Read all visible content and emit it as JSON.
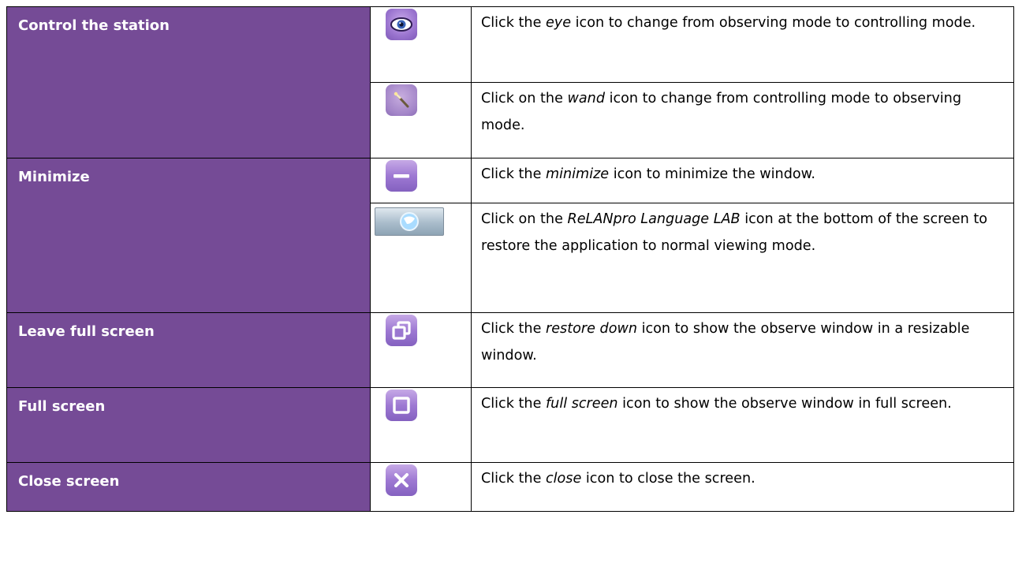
{
  "rows": [
    {
      "feature": "Control the station",
      "icon": "eye-icon",
      "desc": {
        "before": "Click the ",
        "italic": "eye",
        "after": " icon to change from observing mode to controlling mode."
      }
    },
    {
      "feature": "",
      "icon": "wand-icon",
      "desc": {
        "before": "Click on the ",
        "italic": "wand",
        "after": " icon to change from controlling mode to observing mode."
      }
    },
    {
      "feature": "Minimize",
      "icon": "minimize-icon",
      "desc": {
        "before": "Click the ",
        "italic": "minimize",
        "after": " icon to minimize the window."
      }
    },
    {
      "feature": "",
      "icon": "taskbar-app-icon",
      "desc": {
        "before": "Click on the ",
        "italic": "ReLANpro Language LAB",
        "after": " icon at the bottom of the screen to restore the application to normal viewing mode."
      }
    },
    {
      "feature": "Leave full screen",
      "icon": "restore-down-icon",
      "desc": {
        "before": "Click the ",
        "italic": "restore down",
        "after": " icon to show the observe window in a resizable window."
      }
    },
    {
      "feature": "Full screen",
      "icon": "full-screen-icon",
      "desc": {
        "before": "Click the ",
        "italic": "full screen",
        "after": " icon to show the observe window in full screen."
      }
    },
    {
      "feature": "Close screen",
      "icon": "close-icon",
      "desc": {
        "before": "Click the ",
        "italic": "close",
        "after": " icon to close the screen."
      }
    }
  ],
  "colors": {
    "feature_bg": "#754b96",
    "feature_text": "#ffffff",
    "border": "#000000"
  }
}
